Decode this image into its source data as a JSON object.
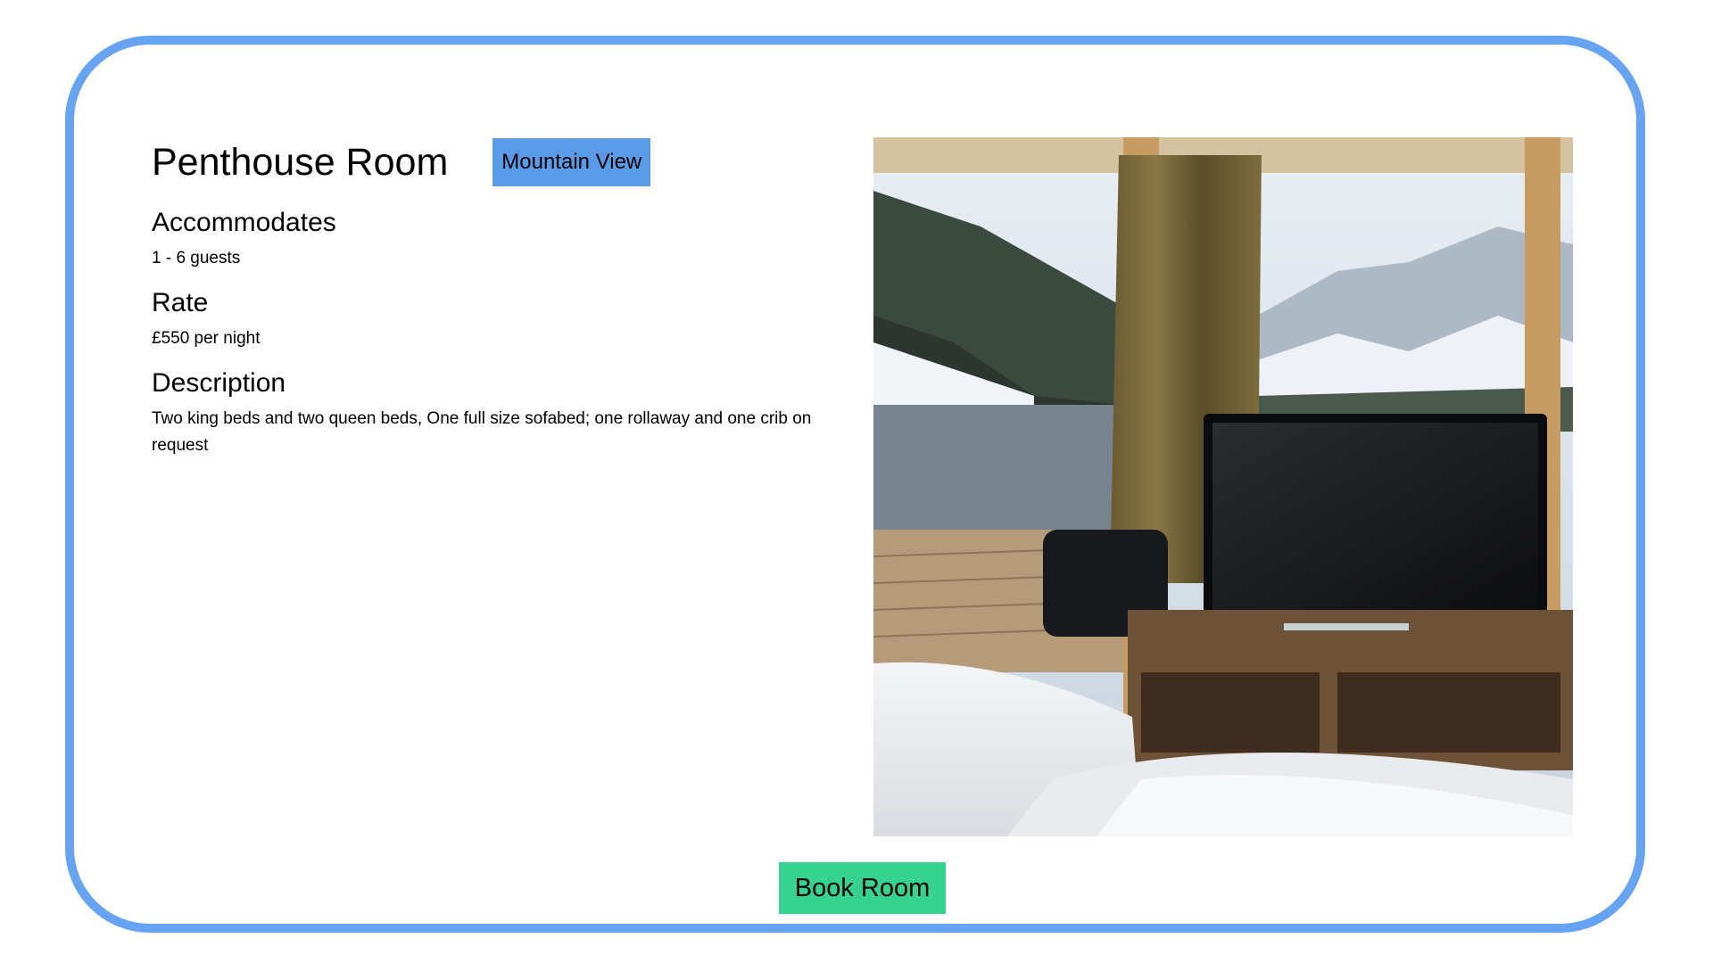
{
  "room": {
    "title": "Penthouse Room",
    "view_tag": "Mountain View",
    "accommodates_heading": "Accommodates",
    "accommodates_value": "1 - 6 guests",
    "rate_heading": "Rate",
    "rate_value": "£550 per night",
    "description_heading": "Description",
    "description_value": "Two king beds and two queen beds, One full size sofabed; one rollaway and one crib on request"
  },
  "actions": {
    "book_label": "Book Room"
  },
  "colors": {
    "card_border": "#66a3f2",
    "tag_background": "#5a9be8",
    "button_background": "#35d38f"
  },
  "image": {
    "subject": "hotel room interior with bed, armchair, television on wooden console and panoramic window with snowy mountain view"
  }
}
